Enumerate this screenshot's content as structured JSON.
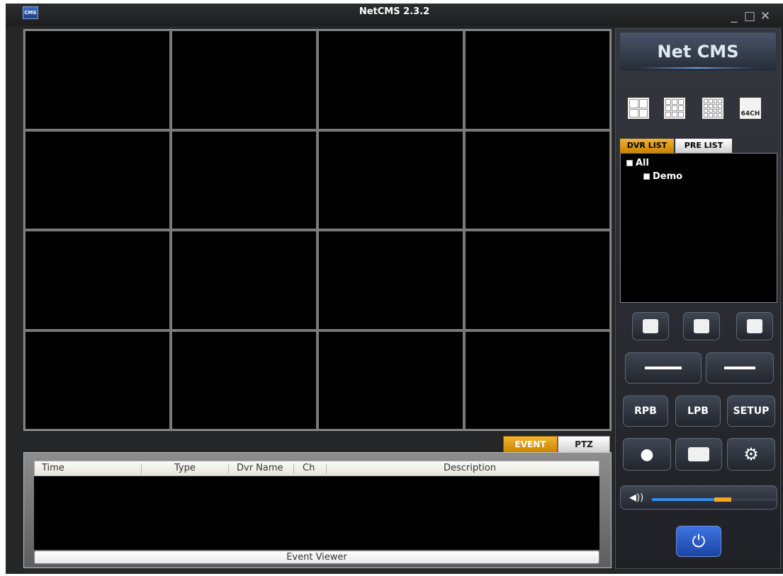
{
  "window": {
    "title": "NetCMS 2.3.2",
    "icon_label": "CMS",
    "minimize": "_",
    "maximize": "□",
    "close": "✕"
  },
  "video": {
    "rows": 4,
    "cols": 4
  },
  "event_tabs": {
    "event": "EVENT",
    "ptz": "PTZ"
  },
  "event_viewer": {
    "columns": [
      "Time",
      "Type",
      "Dvr Name",
      "Ch",
      "Description"
    ],
    "footer": "Event Viewer"
  },
  "side": {
    "brand": "Net CMS",
    "layout_64_label": "64CH",
    "list_tabs": {
      "dvr": "DVR LIST",
      "pre": "PRE LIST"
    },
    "tree": {
      "root": "All",
      "child": "Demo"
    },
    "buttons": {
      "rpb": "RPB",
      "lpb": "LPB",
      "setup": "SETUP"
    },
    "volume_level": 0.57,
    "power_symbol": "⏻"
  },
  "colors": {
    "accent_orange": "#e0a000",
    "accent_blue": "#2d8bf0"
  }
}
